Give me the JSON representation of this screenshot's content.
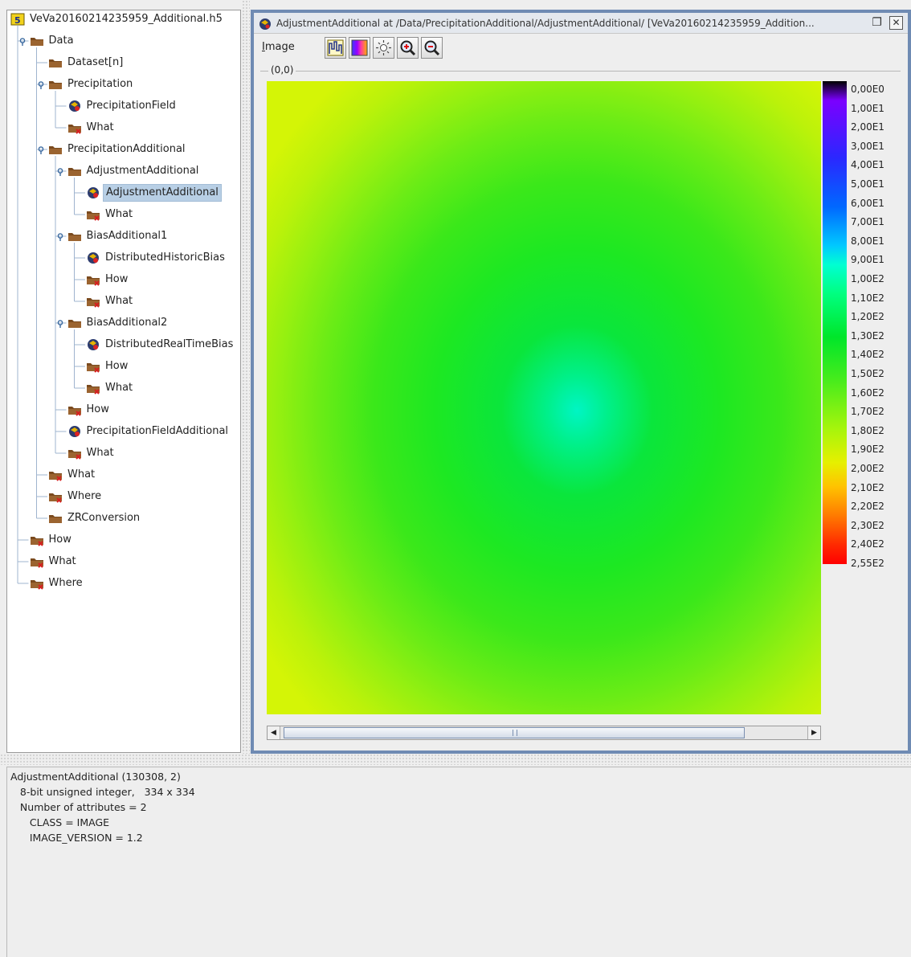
{
  "tree": {
    "root": "VeVa20160214235959_Additional.h5",
    "items": [
      {
        "label": "Data",
        "depth": 1,
        "icon": "folder-icon",
        "toggle": true
      },
      {
        "label": "Dataset[n]",
        "depth": 2,
        "icon": "folder-icon"
      },
      {
        "label": "Precipitation",
        "depth": 2,
        "icon": "folder-icon",
        "toggle": true
      },
      {
        "label": "PrecipitationField",
        "depth": 3,
        "icon": "image-dataset-icon"
      },
      {
        "label": "What",
        "depth": 3,
        "icon": "attribute-folder-icon"
      },
      {
        "label": "PrecipitationAdditional",
        "depth": 2,
        "icon": "folder-icon",
        "toggle": true
      },
      {
        "label": "AdjustmentAdditional",
        "depth": 3,
        "icon": "folder-icon",
        "toggle": true
      },
      {
        "label": "AdjustmentAdditional",
        "depth": 4,
        "icon": "image-dataset-icon",
        "selected": true
      },
      {
        "label": "What",
        "depth": 4,
        "icon": "attribute-folder-icon"
      },
      {
        "label": "BiasAdditional1",
        "depth": 3,
        "icon": "folder-icon",
        "toggle": true
      },
      {
        "label": "DistributedHistoricBias",
        "depth": 4,
        "icon": "image-dataset-icon"
      },
      {
        "label": "How",
        "depth": 4,
        "icon": "attribute-folder-icon"
      },
      {
        "label": "What",
        "depth": 4,
        "icon": "attribute-folder-icon"
      },
      {
        "label": "BiasAdditional2",
        "depth": 3,
        "icon": "folder-icon",
        "toggle": true
      },
      {
        "label": "DistributedRealTimeBias",
        "depth": 4,
        "icon": "image-dataset-icon"
      },
      {
        "label": "How",
        "depth": 4,
        "icon": "attribute-folder-icon"
      },
      {
        "label": "What",
        "depth": 4,
        "icon": "attribute-folder-icon"
      },
      {
        "label": "How",
        "depth": 3,
        "icon": "attribute-folder-icon"
      },
      {
        "label": "PrecipitationFieldAdditional",
        "depth": 3,
        "icon": "image-dataset-icon"
      },
      {
        "label": "What",
        "depth": 3,
        "icon": "attribute-folder-icon"
      },
      {
        "label": "What",
        "depth": 2,
        "icon": "attribute-folder-icon"
      },
      {
        "label": "Where",
        "depth": 2,
        "icon": "attribute-folder-icon"
      },
      {
        "label": "ZRConversion",
        "depth": 2,
        "icon": "folder-icon"
      },
      {
        "label": "How",
        "depth": 1,
        "icon": "attribute-folder-icon"
      },
      {
        "label": "What",
        "depth": 1,
        "icon": "attribute-folder-icon"
      },
      {
        "label": "Where",
        "depth": 1,
        "icon": "attribute-folder-icon"
      }
    ]
  },
  "image_window": {
    "title": "AdjustmentAdditional  at  /Data/PrecipitationAdditional/AdjustmentAdditional/  [VeVa20160214235959_Addition...",
    "menu_image_mnemonic": "I",
    "menu_image_rest": "mage",
    "origin_label": "(0,0)",
    "toolbar": [
      "histogram-icon",
      "palette-icon",
      "brightness-icon",
      "zoom-in-icon",
      "zoom-out-icon"
    ],
    "legend_ticks": [
      "0,00E0",
      "1,00E1",
      "2,00E1",
      "3,00E1",
      "4,00E1",
      "5,00E1",
      "6,00E1",
      "7,00E1",
      "8,00E1",
      "9,00E1",
      "1,00E2",
      "1,10E2",
      "1,20E2",
      "1,30E2",
      "1,40E2",
      "1,50E2",
      "1,60E2",
      "1,70E2",
      "1,80E2",
      "1,90E2",
      "2,00E2",
      "2,10E2",
      "2,20E2",
      "2,30E2",
      "2,40E2",
      "2,55E2"
    ],
    "scroll_grip": "|||"
  },
  "info": {
    "lines": [
      "AdjustmentAdditional (130308, 2)",
      "   8-bit unsigned integer,   334 x 334",
      "   Number of attributes = 2",
      "      CLASS = IMAGE",
      "      IMAGE_VERSION = 1.2"
    ]
  },
  "colors": {
    "selection": "#b8cfe5",
    "window_border": "#6f8bb3",
    "folder": "#7a4a1e",
    "attribute_mark": "#d62020"
  }
}
